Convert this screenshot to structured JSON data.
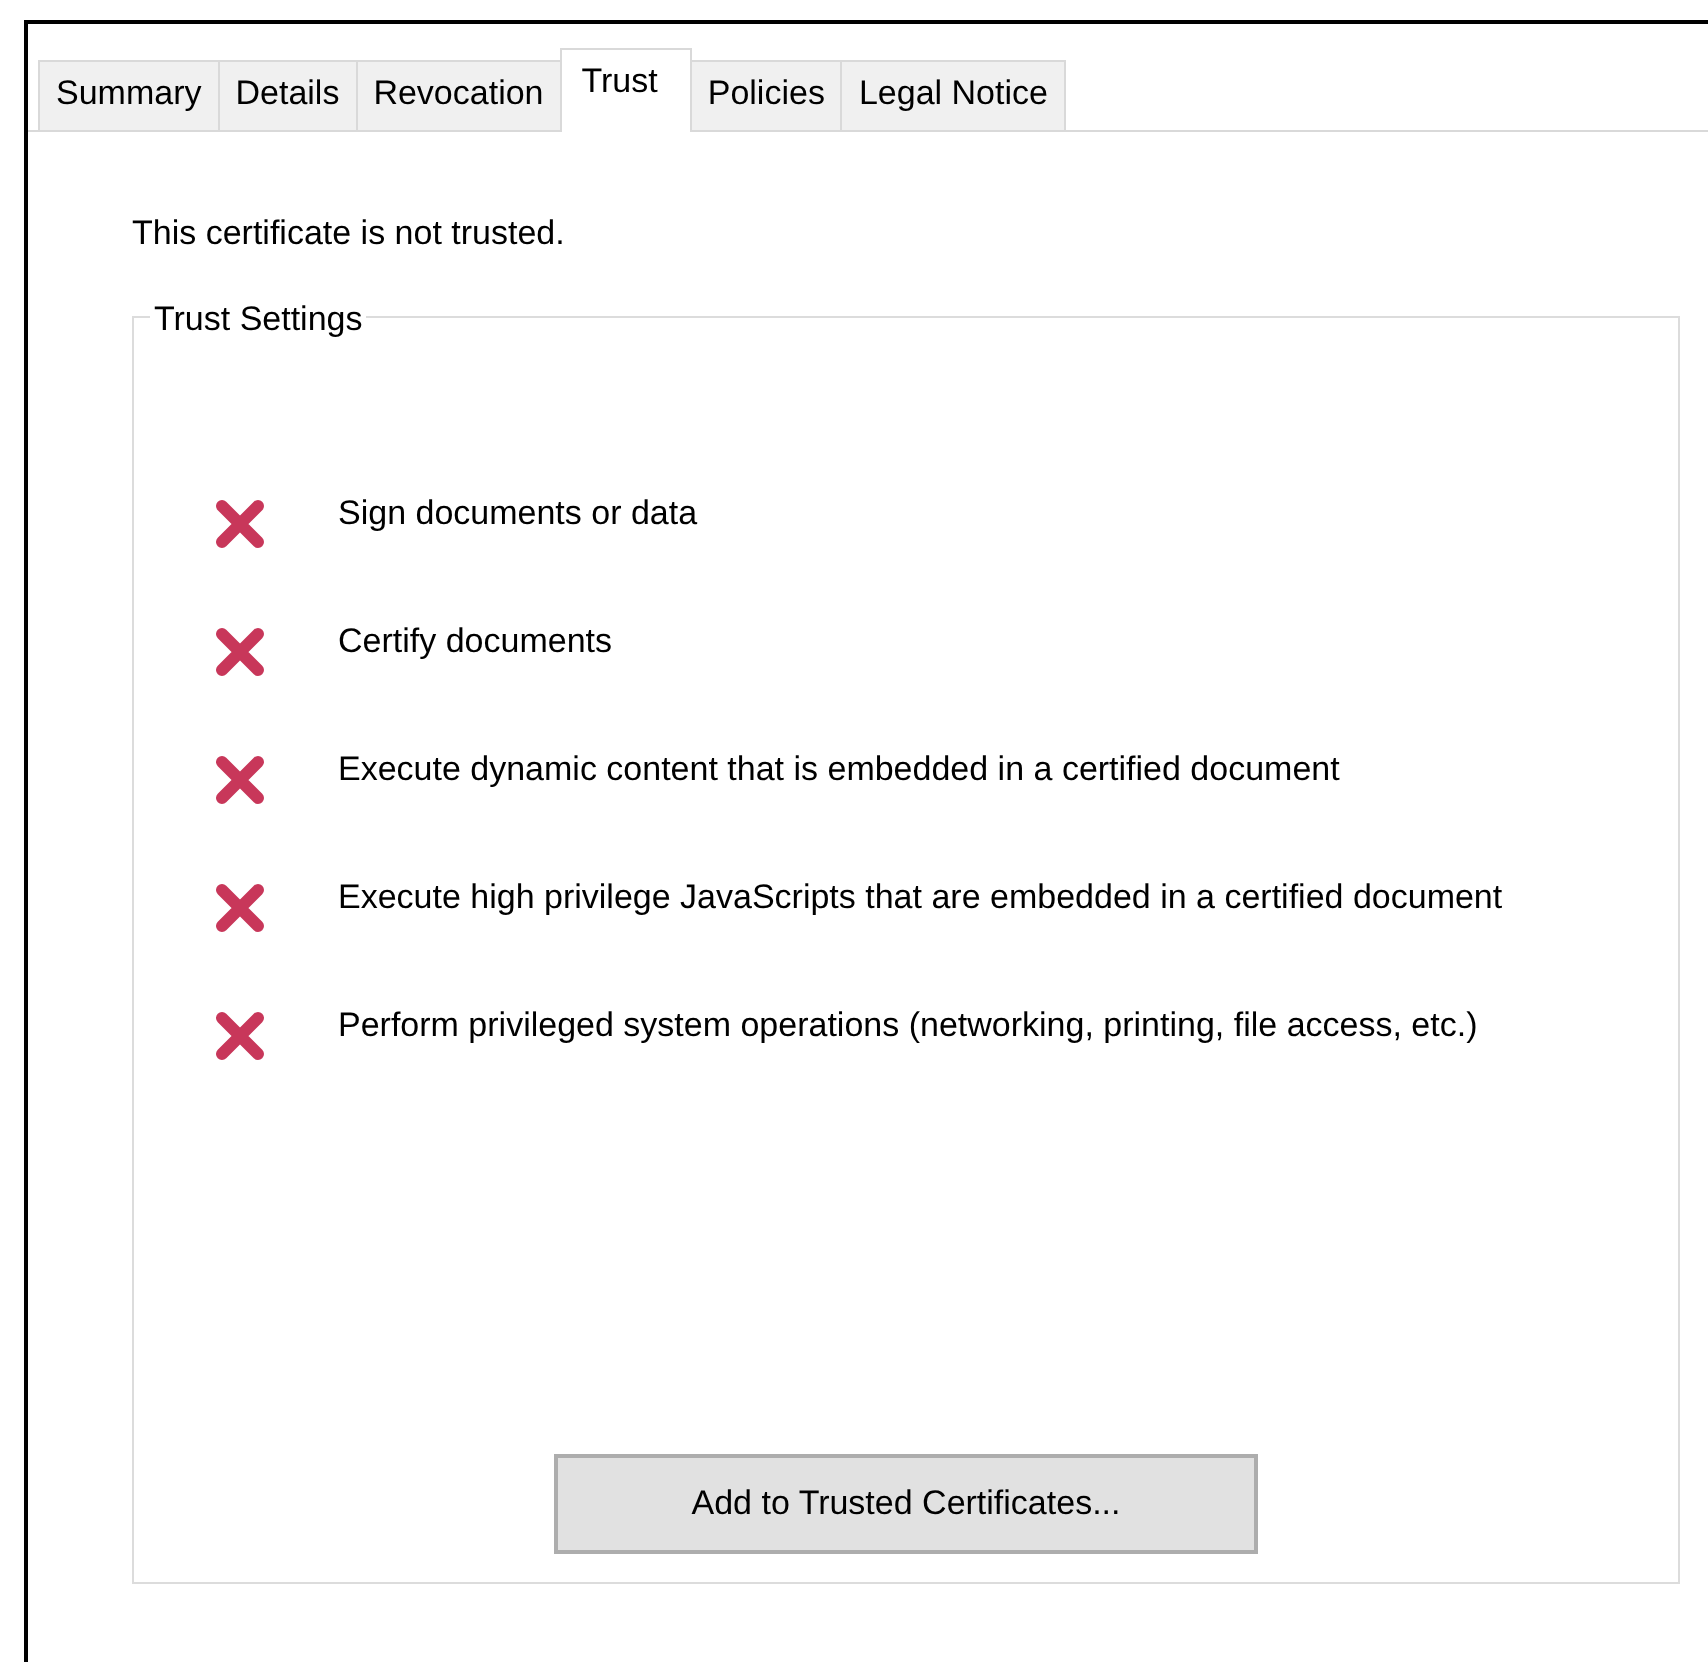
{
  "tabs": [
    {
      "label": "Summary",
      "selected": false
    },
    {
      "label": "Details",
      "selected": false
    },
    {
      "label": "Revocation",
      "selected": false
    },
    {
      "label": "Trust",
      "selected": true
    },
    {
      "label": "Policies",
      "selected": false
    },
    {
      "label": "Legal Notice",
      "selected": false
    }
  ],
  "status_text": "This certificate is not trusted.",
  "trust_settings": {
    "title": "Trust Settings",
    "items": [
      {
        "label": "Sign documents or data",
        "allowed": false
      },
      {
        "label": "Certify documents",
        "allowed": false
      },
      {
        "label": "Execute dynamic content that is embedded in a certified document",
        "allowed": false
      },
      {
        "label": "Execute high privilege JavaScripts that are embedded in a certified document",
        "allowed": false
      },
      {
        "label": "Perform privileged system operations (networking, printing, file access, etc.)",
        "allowed": false
      }
    ],
    "button": "Add to Trusted Certificates..."
  }
}
